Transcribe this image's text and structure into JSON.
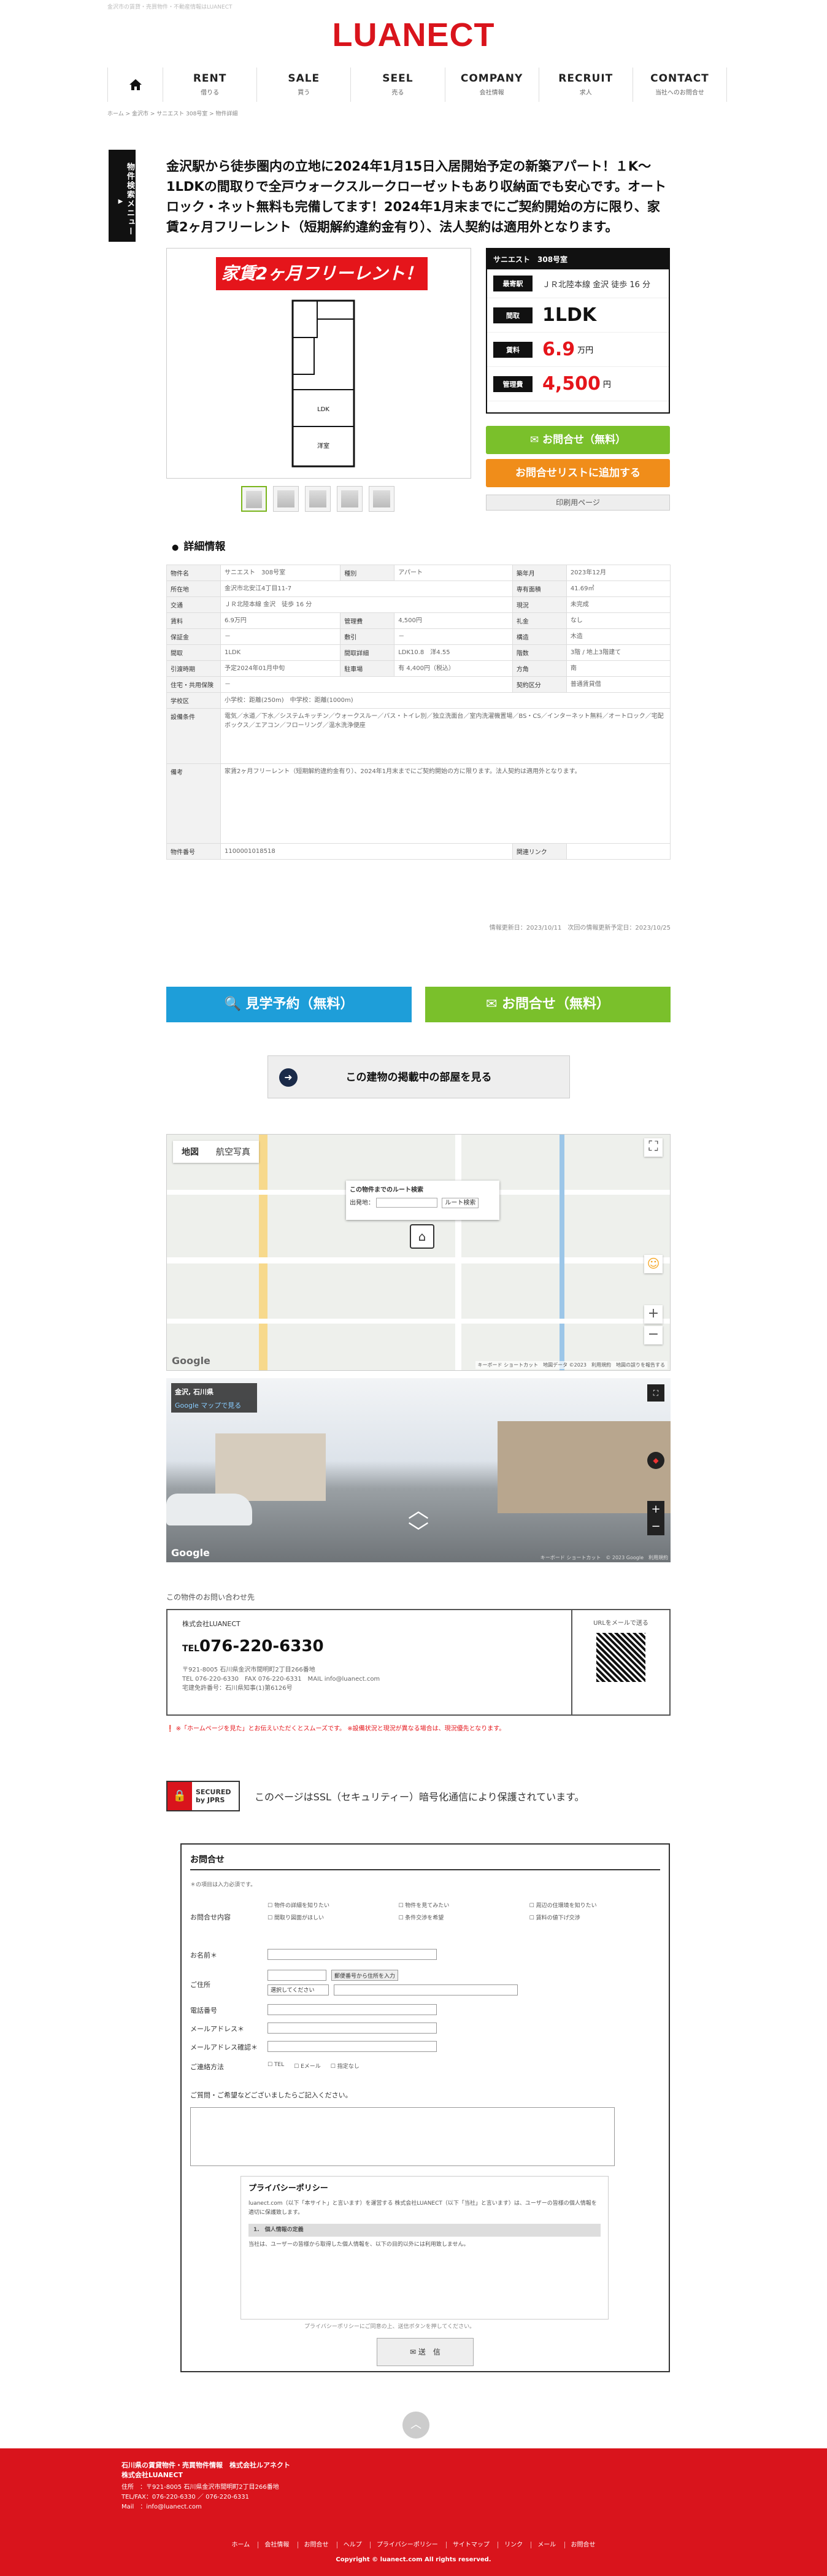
{
  "topnote": "金沢市の賃貸・売買物件・不動産情報はLUANECT",
  "logo": "LUANECT",
  "gnav": [
    {
      "en": "RENT",
      "jp": "借りる"
    },
    {
      "en": "SALE",
      "jp": "買う"
    },
    {
      "en": "SEEL",
      "jp": "売る"
    },
    {
      "en": "COMPANY",
      "jp": "会社情報"
    },
    {
      "en": "RECRUIT",
      "jp": "求人"
    },
    {
      "en": "CONTACT",
      "jp": "当社へのお問合せ"
    }
  ],
  "breadcrumb": "ホーム > 金沢市 > サニエスト 308号室 > 物件詳細",
  "sidetab": "物件検索メニュー",
  "headline": "金沢駅から徒歩圏内の立地に2024年1月15日入居開始予定の新築アパート！１K～1LDKの間取りで全戸ウォークスルークローゼットもあり収納面でも安心です。オートロック・ネット無料も完備してます！2024年1月末までにご契約開始の方に限り、家賃2ヶ月フリーレント（短期解約違約金有り）、法人契約は適用外となります。",
  "banner": "家賃2ヶ月フリーレント！",
  "infobox": {
    "name": "サニエスト　308号室",
    "station_label": "最寄駅",
    "station": "ＪＲ北陸本線 金沢 徒歩 16 分",
    "layout_label": "間取",
    "layout": "1LDK",
    "rent_label": "賃料",
    "rent": "6.9",
    "rent_unit": "万円",
    "fee_label": "管理費",
    "fee": "4,500",
    "fee_unit": "円"
  },
  "buttons": {
    "inquiry": "✉ お問合せ（無料）",
    "addlist": "お問合せリストに追加する",
    "print": "印刷用ページ"
  },
  "detail_title": "詳細情報",
  "spec": [
    [
      "物件名",
      "サニエスト　308号室",
      "種別",
      "アパート",
      "築年月",
      "2023年12月"
    ],
    [
      "所在地",
      "金沢市北安江4丁目11-7",
      "",
      "",
      "専有面積",
      "41.69㎡"
    ],
    [
      "交通",
      "ＪＲ北陸本線 金沢　徒歩 16 分",
      "",
      "",
      "現況",
      "未完成"
    ],
    [
      "賃料",
      "6.9万円",
      "管理費",
      "4,500円",
      "礼金",
      "なし"
    ],
    [
      "保証金",
      "－",
      "敷引",
      "－",
      "構造",
      "木造"
    ],
    [
      "間取",
      "1LDK",
      "間取詳細",
      "LDK10.8　洋4.55",
      "",
      ""
    ],
    [
      "引渡時期",
      "予定2024年01月中旬",
      "",
      "",
      "駐車場",
      "有 4,400円（税込）"
    ],
    [
      "住宅・共用保険",
      "－",
      "",
      "",
      "契約区分",
      "普通賃貸借"
    ],
    [
      "学校区",
      "",
      "",
      "",
      "",
      ""
    ],
    [
      "設備条件",
      "",
      "",
      "",
      "",
      ""
    ],
    [
      "備考",
      "",
      "",
      "",
      "",
      ""
    ],
    [
      "物件番号",
      "1100001018518",
      "",
      "",
      "関連リンク",
      ""
    ]
  ],
  "extra_spec": {
    "deposit_label": "敷金",
    "deposit": "なし",
    "floor_label": "階数",
    "floor": "3階 / 地上3階建て",
    "direction_label": "方角",
    "direction": "南",
    "school": "小学校：距離(250m)　中学校：距離(1000m)",
    "equip": "電気／水道／下水／システムキッチン／ウォークスルー／バス・トイレ別／独立洗面台／室内洗濯機置場／BS・CS／インターネット無料／オートロック／宅配ボックス／エアコン／フローリング／温水洗浄便座",
    "notes": "家賃2ヶ月フリーレント（短期解約違約金有り）、2024年1月末までにご契約開始の方に限ります。法人契約は適用外となります。"
  },
  "updated": "情報更新日：2023/10/11　次回の情報更新予定日：2023/10/25",
  "cta": {
    "visit": "見学予約（無料）",
    "inquiry": "お問合せ（無料）"
  },
  "rooms_btn": "この建物の掲載中の部屋を見る",
  "map": {
    "tab_map": "地図",
    "tab_sat": "航空写真",
    "route_title": "この物件までのルート検索",
    "route_from": "出発地：",
    "route_btn": "ルート検索",
    "attribution": "キーボード ショートカット　地図データ ©2023　利用規約　地図の誤りを報告する",
    "google": "Google"
  },
  "streetview": {
    "addr": "金沢, 石川県",
    "link": "Google マップで見る",
    "attribution": "キーボード ショートカット　© 2023 Google　利用規約"
  },
  "contact_caption": "この物件のお問い合わせ先",
  "contact": {
    "company": "株式会社LUANECT",
    "tel_prefix": "TEL",
    "tel": "076-220-6330",
    "address": "〒921-8005 石川県金沢市間明町2丁目266番地",
    "telfax": "TEL 076-220-6330　FAX 076-220-6331　MAIL info@luanect.com",
    "license": "宅建免許番号：石川県知事(1)第6126号",
    "qr_caption": "URLをメールで送る"
  },
  "notice": "※「ホームページを見た」とお伝えいただくとスムーズです。 ※設備状況と現況が異なる場合は、現況優先となります。",
  "ssl": {
    "badge1": "SECURED",
    "badge2": "by JPRS",
    "message": "このページはSSL（セキュリティー）暗号化通信により保護されています。"
  },
  "form": {
    "title": "お問合せ",
    "required_note": "＊の項目は入力必須です。",
    "content_label": "お問合せ内容",
    "checks": [
      "物件の詳細を知りたい",
      "物件を見てみたい",
      "周辺の住環境を知りたい",
      "間取り図面がほしい",
      "条件交渉を希望",
      "賃料の値下げ交渉"
    ],
    "name_label": "お名前＊",
    "address_label": "ご住所",
    "zip_btn": "郵便番号から住所を入力",
    "select_placeholder": "選択してください",
    "tel_label": "電話番号",
    "mail_label": "メールアドレス＊",
    "mail2_label": "メールアドレス確認＊",
    "contact_method_label": "ご連絡方法",
    "methods": [
      "TEL",
      "Eメール",
      "指定なし"
    ],
    "free_label": "ご質問・ご希望などございましたらご記入ください。",
    "policy_title": "プライバシーポリシー",
    "policy_text": "luanect.com（以下「本サイト」と言います）を運営する 株式会社LUANECT（以下「当社」と言います）は、ユーザーの皆様の個人情報を適切に保護致します。",
    "policy_heading": "1.　個人情報の定義",
    "policy_text2": "当社は、ユーザーの皆様から取得した個人情報を、以下の目的以外には利用致しません。",
    "policy_note": "プライバシーポリシーにご同意の上、送信ボタンを押してください。",
    "send": "送　信"
  },
  "footer": {
    "line1": "石川県の賃貸物件・売買物件情報　株式会社ルアネクト",
    "line2": "株式会社LUANECT",
    "addr": "住所　：〒921-8005 石川県金沢市間明町2丁目266番地",
    "tel": "TEL/FAX：076-220-6330 ／ 076-220-6331",
    "mail": "Mail　：info@luanect.com",
    "nav": [
      "ホーム",
      "会社情報",
      "お問合せ",
      "ヘルプ",
      "プライバシーポリシー",
      "サイトマップ",
      "リンク",
      "メール",
      "お問合せ"
    ],
    "copyright": "Copyright © luanect.com All rights reserved."
  }
}
